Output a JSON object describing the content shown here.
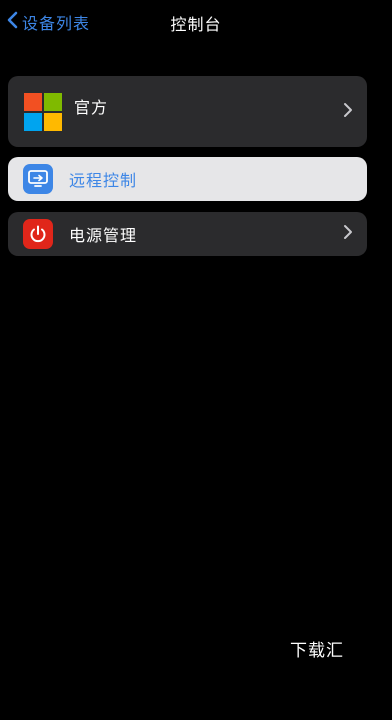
{
  "nav": {
    "back_label": "设备列表",
    "title": "控制台"
  },
  "rows": {
    "official": {
      "label": "官方",
      "icon": "microsoft-logo-icon"
    },
    "remote": {
      "label": "远程控制",
      "icon": "remote-screen-icon"
    },
    "power": {
      "label": "电源管理",
      "icon": "power-icon"
    }
  },
  "watermark": "下载汇",
  "colors": {
    "background": "#000000",
    "row_background": "#2b2b2d",
    "selected_row_background": "#e6e6e8",
    "accent": "#3d86e6",
    "power_icon_background": "#e0261a",
    "ms_red": "#f25022",
    "ms_green": "#7fba00",
    "ms_blue": "#00a4ef",
    "ms_yellow": "#ffb900"
  }
}
